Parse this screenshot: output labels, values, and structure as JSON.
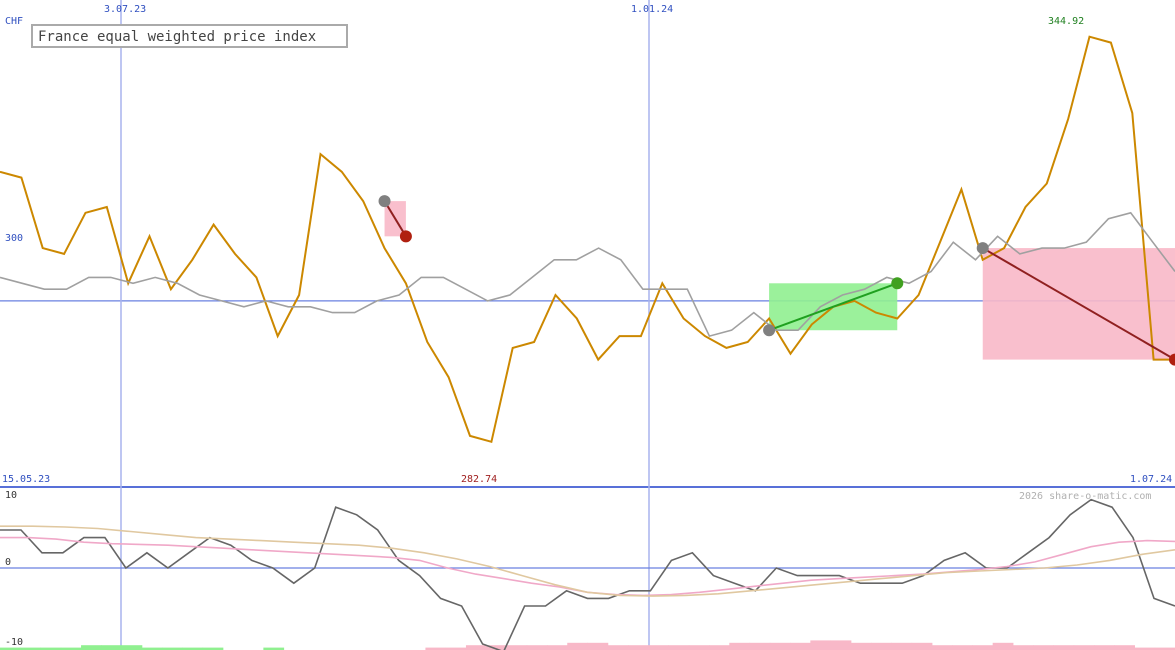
{
  "chart_data": [
    {
      "type": "line",
      "title": "France equal weighted price index",
      "currency": "CHF",
      "y_reference_label": "300",
      "y_reference_value": 300,
      "start_label": "15.05.23",
      "end_label": "1.07.24",
      "min_label": "282.74",
      "max_label": "344.92",
      "x_tick_labels": [
        "3.07.23",
        "1.01.24"
      ],
      "ylim": [
        270,
        347
      ],
      "series": [
        {
          "name": "",
          "color": "#cc8800",
          "values": [
            322,
            321,
            309,
            308,
            315,
            316,
            303,
            311,
            302,
            307,
            313,
            308,
            304,
            294,
            301,
            325,
            322,
            317,
            309,
            303,
            293,
            287,
            277,
            276,
            292,
            293,
            301,
            297,
            290,
            294,
            294,
            303,
            297,
            294,
            292,
            293,
            297,
            291,
            296,
            299,
            300,
            298,
            297,
            301,
            310,
            319,
            307,
            309,
            316,
            320,
            331,
            345,
            344,
            332,
            290,
            290
          ]
        },
        {
          "name": "",
          "color": "#a0a0a0",
          "values": [
            304,
            303,
            302,
            302,
            304,
            304,
            303,
            304,
            303,
            301,
            300,
            299,
            300,
            299,
            299,
            298,
            298,
            300,
            301,
            304,
            304,
            302,
            300,
            301,
            304,
            307,
            307,
            309,
            307,
            302,
            302,
            302,
            294,
            295,
            298,
            295,
            295,
            299,
            301,
            302,
            304,
            303,
            305,
            310,
            307,
            311,
            308,
            309,
            309,
            310,
            314,
            315,
            310,
            305
          ]
        }
      ],
      "segments": [
        {
          "from": 317,
          "to": 311,
          "result": "loss"
        },
        {
          "from": 295,
          "to": 303,
          "result": "gain"
        },
        {
          "from": 309,
          "to": 290,
          "result": "loss"
        }
      ]
    },
    {
      "type": "line",
      "title": "",
      "ylim": [
        -10,
        10
      ],
      "y_tick_labels": [
        "10",
        "0",
        "-10"
      ],
      "series": [
        {
          "name": "",
          "color": "#666666",
          "values": [
            5,
            5,
            2,
            2,
            4,
            4,
            0,
            2,
            0,
            2,
            4,
            3,
            1,
            0,
            -2,
            0,
            8,
            7,
            5,
            1,
            -1,
            -4,
            -5,
            -10,
            -11,
            -5,
            -5,
            -3,
            -4,
            -4,
            -3,
            -3,
            1,
            2,
            -1,
            -2,
            -3,
            0,
            -1,
            -1,
            -1,
            -2,
            -2,
            -2,
            -1,
            1,
            2,
            0,
            0,
            2,
            4,
            7,
            9,
            8,
            4,
            -4,
            -5
          ]
        },
        {
          "name": "",
          "color": "#f0a8c8",
          "values": [
            4,
            4,
            3.8,
            3.4,
            3.2,
            3.1,
            3,
            2.8,
            2.6,
            2.4,
            2.2,
            2,
            1.8,
            1.6,
            1.4,
            1,
            0,
            -0.8,
            -1.4,
            -2,
            -2.5,
            -3.2,
            -3.5,
            -3.6,
            -3.5,
            -3.2,
            -2.8,
            -2.4,
            -2,
            -1.6,
            -1.4,
            -1.2,
            -1,
            -0.8,
            -0.5,
            -0.2,
            0.2,
            0.8,
            1.8,
            2.8,
            3.4,
            3.6,
            3.5
          ]
        },
        {
          "name": "",
          "color": "#e0c8a0",
          "values": [
            5.5,
            5.5,
            5.4,
            5.2,
            4.8,
            4.4,
            4,
            3.8,
            3.6,
            3.4,
            3.2,
            3,
            2.6,
            2,
            1.2,
            0.2,
            -1,
            -2.2,
            -3.2,
            -3.6,
            -3.7,
            -3.6,
            -3.4,
            -3,
            -2.6,
            -2.2,
            -1.8,
            -1.4,
            -1,
            -0.6,
            -0.4,
            -0.2,
            0,
            0.4,
            1,
            1.8,
            2.4
          ]
        }
      ],
      "volume_bars": {
        "colors": {
          "up": "#90f090",
          "down": "#f8b8c8"
        },
        "values": [
          1,
          1,
          1,
          1,
          2,
          2,
          2,
          1,
          1,
          1,
          1,
          0,
          0,
          1,
          0,
          0,
          0,
          0,
          0,
          0,
          0,
          -1,
          -1,
          -2,
          -2,
          -2,
          -2,
          -2,
          -3,
          -3,
          -2,
          -2,
          -2,
          -2,
          -2,
          -2,
          -3,
          -3,
          -3,
          -3,
          -4,
          -4,
          -3,
          -3,
          -3,
          -3,
          -2,
          -2,
          -2,
          -3,
          -2,
          -2,
          -2,
          -2,
          -2,
          -2,
          -1,
          -1
        ]
      }
    }
  ],
  "watermark": "2026 share-o-matic.com"
}
